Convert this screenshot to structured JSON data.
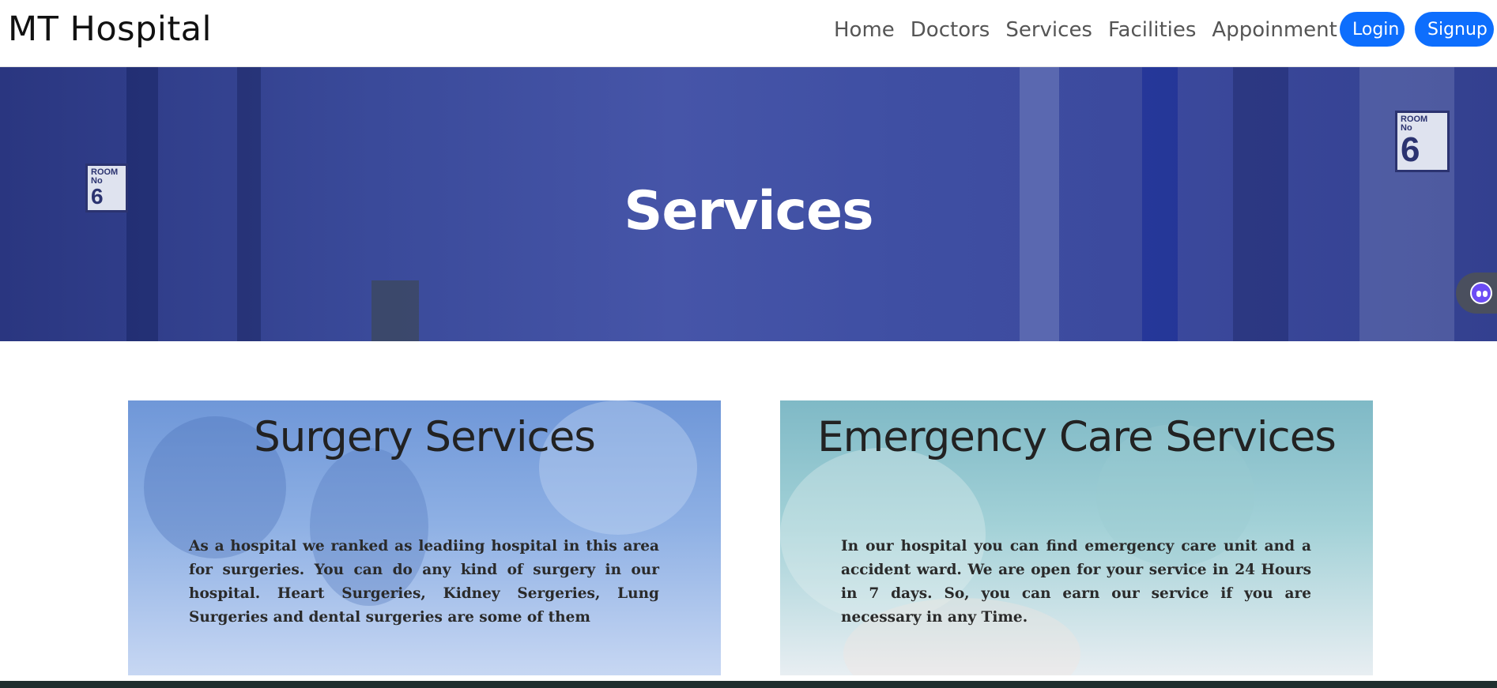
{
  "navbar": {
    "brand": "MT Hospital",
    "links": [
      "Home",
      "Doctors",
      "Services",
      "Facilities",
      "Appoinment"
    ],
    "login_label": "Login",
    "signup_label": "Signup"
  },
  "hero": {
    "title": "Services",
    "room_sign": {
      "room": "ROOM",
      "no": "No",
      "number": "6"
    }
  },
  "cards": [
    {
      "title": "Surgery Services",
      "text": "As a hospital we ranked as leadiing hospital in this area for surgeries. You can do any kind of surgery in our hospital. Heart Surgeries, Kidney Sergeries, Lung Surgeries and dental surgeries are some of them"
    },
    {
      "title": "Emergency Care Services",
      "text": "In our hospital you can find emergency care unit and a accident ward. We are open for your service in 24 Hours in 7 days. So, you can earn our service if you are necessary in any Time."
    }
  ],
  "colors": {
    "primary": "#0d6efd",
    "hero_overlay": "#3a4a9a",
    "footer": "#1f2e2e"
  }
}
